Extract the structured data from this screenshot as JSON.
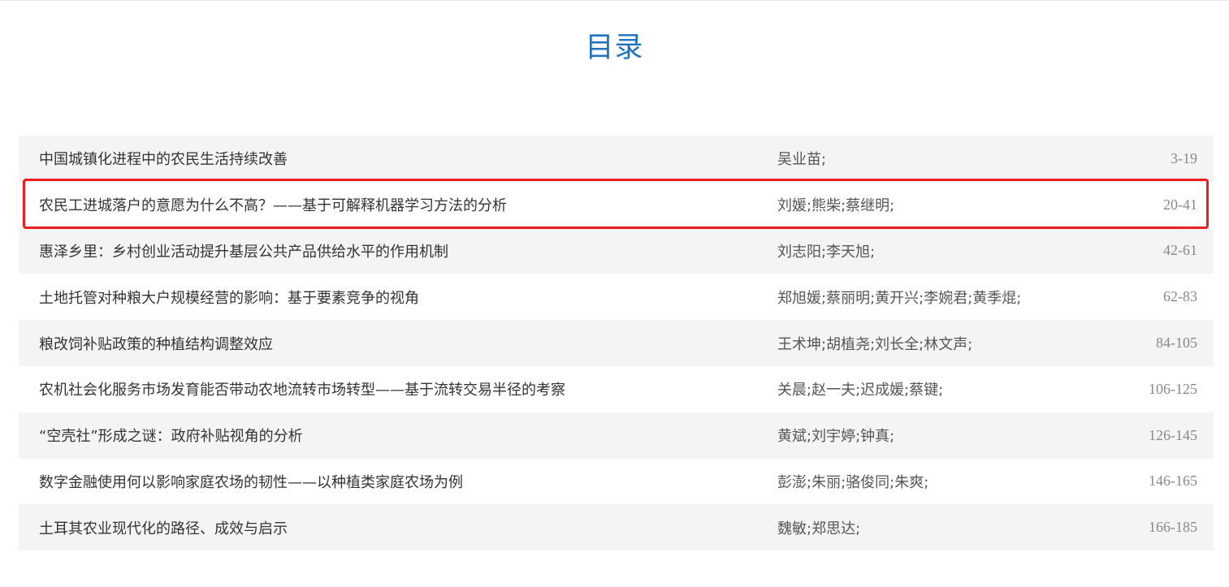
{
  "page": {
    "title": "目录",
    "title_color": "#1f73c0"
  },
  "highlight": {
    "color": "#ee1c1c",
    "row_index": 1
  },
  "toc": [
    {
      "title": "中国城镇化进程中的农民生活持续改善",
      "authors": "吴业苗;",
      "pages": "3-19"
    },
    {
      "title": "农民工进城落户的意愿为什么不高？——基于可解释机器学习方法的分析",
      "authors": "刘媛;熊柴;蔡继明;",
      "pages": "20-41"
    },
    {
      "title": "惠泽乡里：乡村创业活动提升基层公共产品供给水平的作用机制",
      "authors": "刘志阳;李天旭;",
      "pages": "42-61"
    },
    {
      "title": "土地托管对种粮大户规模经营的影响：基于要素竞争的视角",
      "authors": "郑旭媛;蔡丽明;黄开兴;李婉君;黄季焜;",
      "pages": "62-83"
    },
    {
      "title": "粮改饲补贴政策的种植结构调整效应",
      "authors": "王术坤;胡植尧;刘长全;林文声;",
      "pages": "84-105"
    },
    {
      "title": "农机社会化服务市场发育能否带动农地流转市场转型——基于流转交易半径的考察",
      "authors": "关晨;赵一夫;迟成媛;蔡键;",
      "pages": "106-125"
    },
    {
      "title": "“空壳社”形成之谜：政府补贴视角的分析",
      "authors": "黄斌;刘宇婷;钟真;",
      "pages": "126-145"
    },
    {
      "title": "数字金融使用何以影响家庭农场的韧性——以种植类家庭农场为例",
      "authors": "彭澎;朱丽;骆俊同;朱爽;",
      "pages": "146-165"
    },
    {
      "title": "土耳其农业现代化的路径、成效与启示",
      "authors": "魏敏;郑思达;",
      "pages": "166-185"
    }
  ]
}
